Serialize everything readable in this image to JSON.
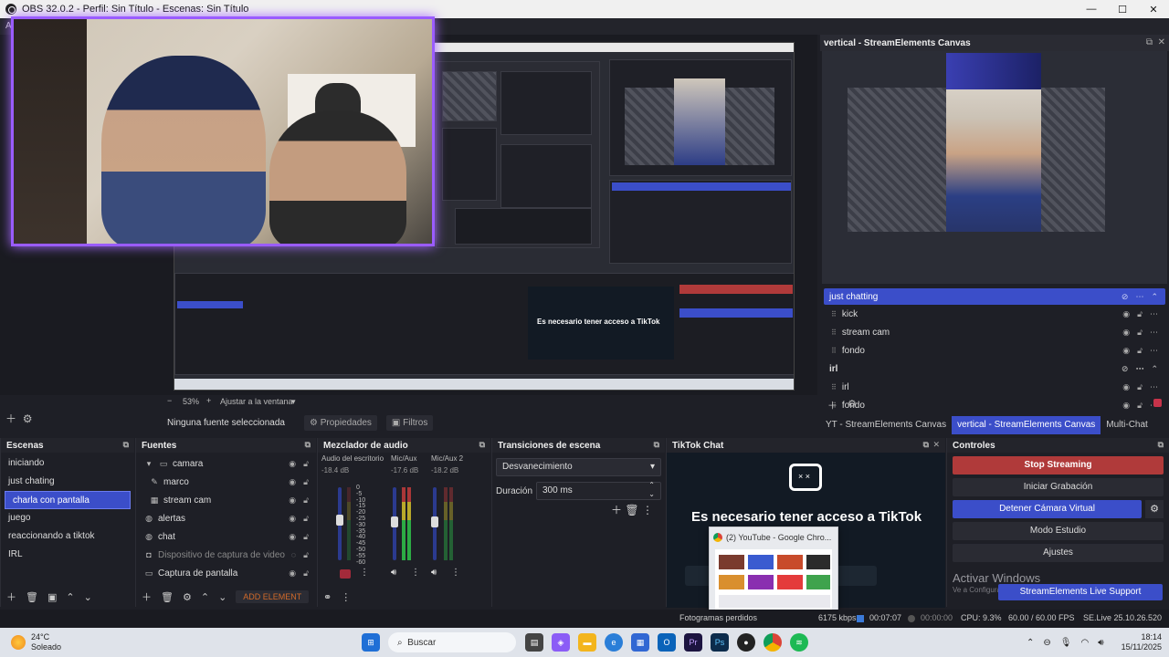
{
  "window": {
    "title": "OBS 32.0.2 - Perfil: Sin Título - Escenas: Sin Título"
  },
  "preview": {
    "zoom": "53%",
    "zoom_mode": "Ajustar a la ventana",
    "inner_tiktok_text": "Es necesario tener acceso a TikTok"
  },
  "source_bar": {
    "selection": "Ninguna fuente seleccionada",
    "properties": "Propiedades",
    "filters": "Filtros"
  },
  "vertical": {
    "title": "vertical - StreamElements Canvas",
    "groups": [
      {
        "name": "just chatting",
        "items": [
          "kick",
          "stream cam",
          "fondo"
        ]
      },
      {
        "name": "irl",
        "items": [
          "irl",
          "fondo"
        ]
      }
    ]
  },
  "canvas_tabs": [
    "YT - StreamElements Canvas",
    "vertical - StreamElements Canvas",
    "Multi-Chat"
  ],
  "scenes": {
    "title": "Escenas",
    "items": [
      "iniciando",
      "just chating",
      "charla con pantalla",
      "juego",
      "reaccionando a tiktok",
      "IRL"
    ],
    "selected_index": 2
  },
  "sources": {
    "title": "Fuentes",
    "items": [
      {
        "label": "camara",
        "icon": "folder-icon"
      },
      {
        "label": "marco",
        "icon": "brush-icon"
      },
      {
        "label": "stream cam",
        "icon": "video-icon"
      },
      {
        "label": "alertas",
        "icon": "globe-icon"
      },
      {
        "label": "chat",
        "icon": "globe-icon"
      },
      {
        "label": "Dispositivo de captura de video",
        "icon": "camera-icon"
      },
      {
        "label": "Captura de pantalla",
        "icon": "monitor-icon"
      }
    ],
    "add_element": "ADD ELEMENT"
  },
  "mixer": {
    "title": "Mezclador de audio",
    "channels": [
      {
        "name": "Audio del escritorio",
        "db": "-18.4 dB"
      },
      {
        "name": "Mic/Aux",
        "db": "-17.6 dB"
      },
      {
        "name": "Mic/Aux 2",
        "db": "-18.2 dB"
      }
    ],
    "scale": [
      "0",
      "-5",
      "-10",
      "-15",
      "-20",
      "-25",
      "-30",
      "-35",
      "-40",
      "-45",
      "-50",
      "-55",
      "-60"
    ]
  },
  "transitions": {
    "title": "Transiciones de escena",
    "type": "Desvanecimiento",
    "duration_label": "Duración",
    "duration": "300 ms"
  },
  "tiktok": {
    "title": "TikTok Chat",
    "message": "Es necesario tener acceso a TikTok",
    "thumb_title": "(2) YouTube - Google Chro..."
  },
  "controls": {
    "title": "Controles",
    "buttons": [
      "Stop Streaming",
      "Iniciar Grabación",
      "Detener Cámara Virtual",
      "Modo Estudio",
      "Ajustes",
      "StreamElements Live Support"
    ],
    "watermark": "Activar Windows",
    "watermark_sub": "Ve a Configuración para activar Windows."
  },
  "status": {
    "dropped": "Fotogramas perdidos",
    "kbps": "6175 kbps",
    "live_time": "00:07:07",
    "rec_time": "00:00:00",
    "cpu": "CPU: 9.3%",
    "fps": "60.00 / 60.00 FPS",
    "version": "SE.Live 25.10.26.520"
  },
  "taskbar": {
    "temp": "24°C",
    "weather": "Soleado",
    "search": "Buscar",
    "time": "18:14",
    "date": "15/11/2025"
  },
  "colors": {
    "accent": "#3b4ec9",
    "stop": "#b03a3a",
    "add": "#d26a2a"
  }
}
